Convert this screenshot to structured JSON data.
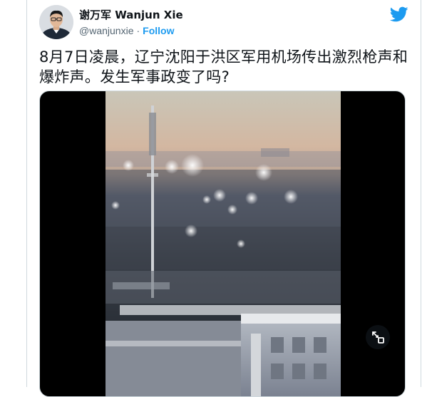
{
  "tweet": {
    "author": {
      "display_name": "谢万军 Wanjun Xie",
      "handle": "@wanjunxie",
      "separator": "·",
      "follow_label": "Follow"
    },
    "text": "8月7日凌晨，辽宁沈阳于洪区军用机场传出激烈枪声和爆炸声。发生军事政变了吗?",
    "media": {
      "type": "video",
      "controls": [
        "expand-icon"
      ]
    }
  },
  "colors": {
    "brand": "#1d9bf0",
    "text_primary": "#0f1419",
    "text_secondary": "#536471",
    "border": "#cfd9de"
  },
  "icons": [
    "twitter-bird-icon",
    "expand-icon"
  ]
}
